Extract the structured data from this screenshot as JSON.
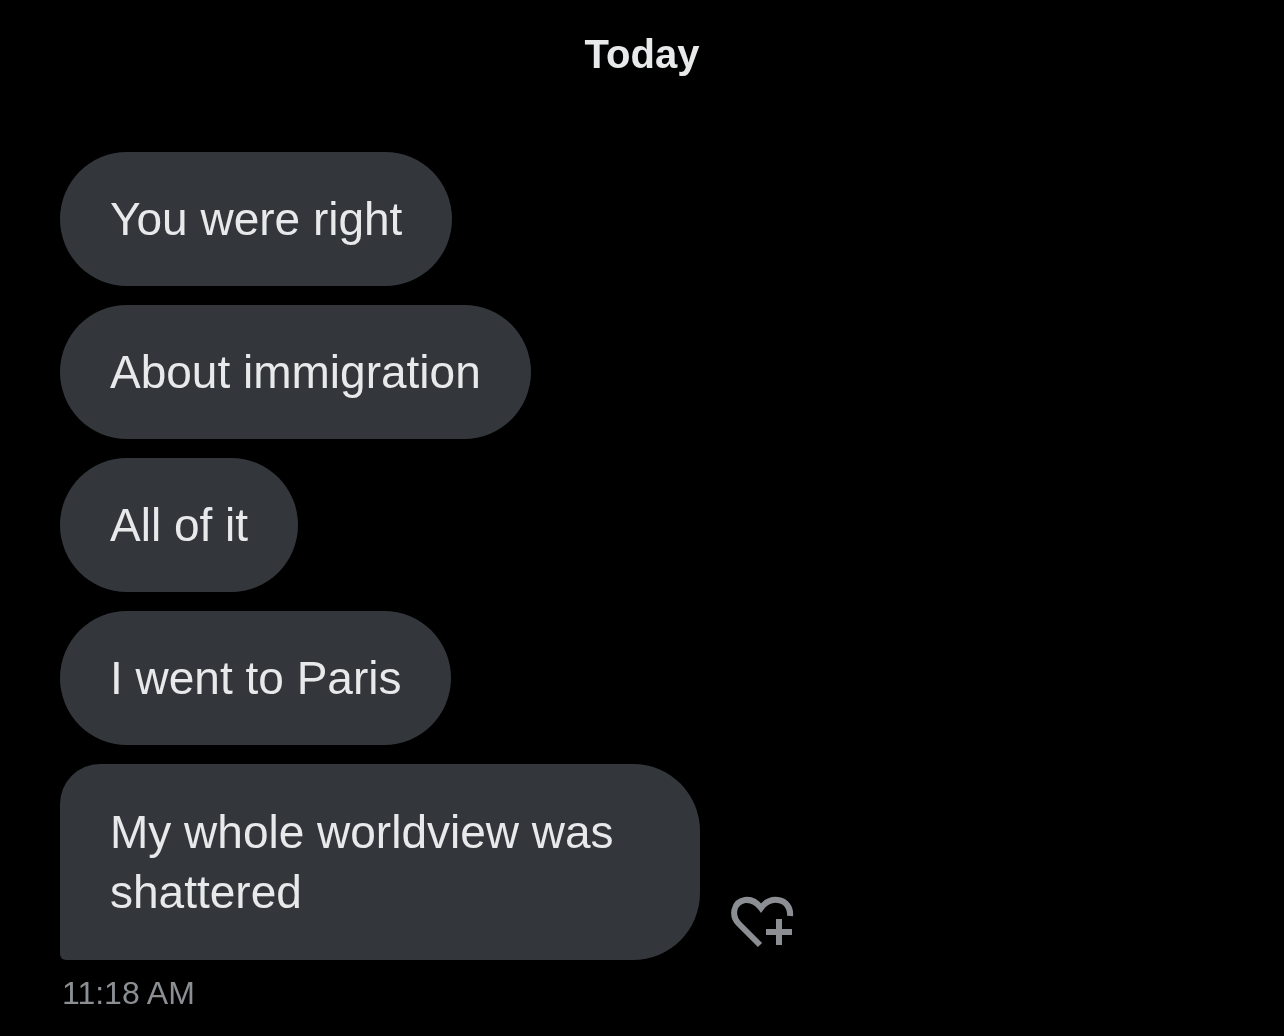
{
  "date_divider": "Today",
  "messages": [
    {
      "text": "You were right"
    },
    {
      "text": "About immigration"
    },
    {
      "text": "All of it"
    },
    {
      "text": "I went to Paris"
    },
    {
      "text": "My whole worldview was shattered"
    }
  ],
  "timestamp": "11:18 AM"
}
